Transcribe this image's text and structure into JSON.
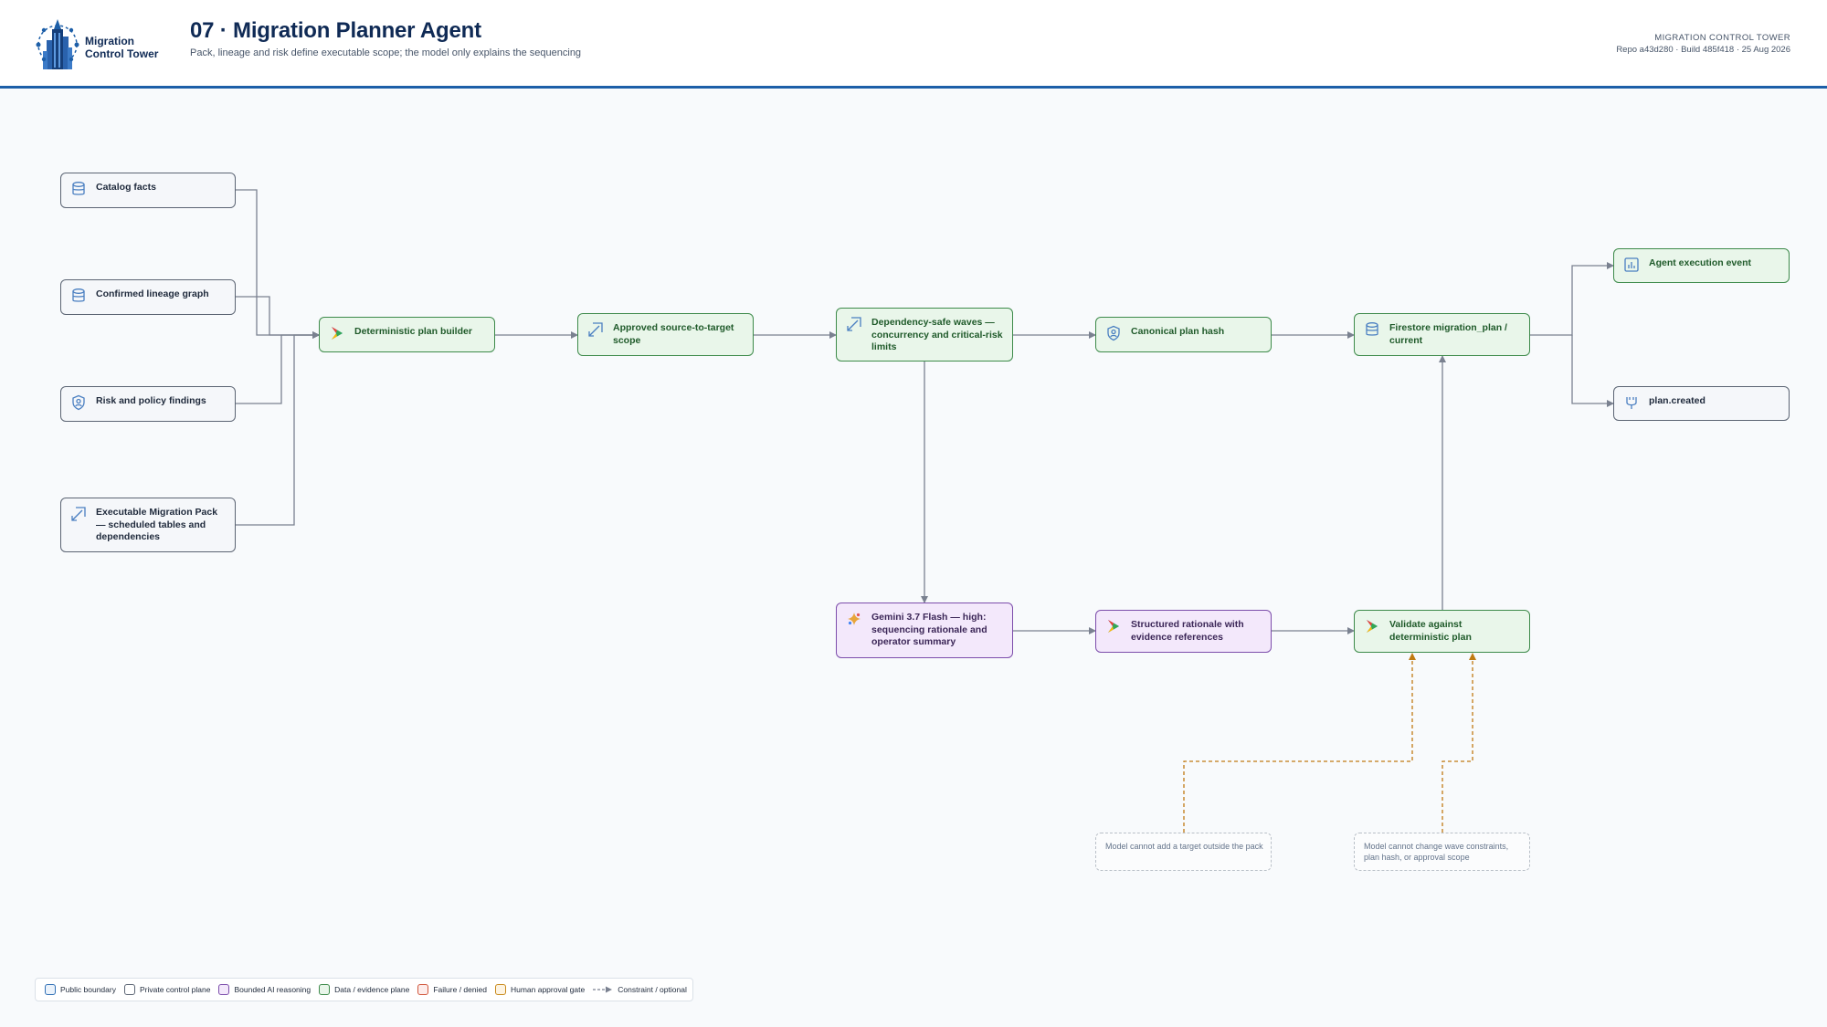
{
  "header": {
    "logo_line1": "Migration",
    "logo_line2": "Control Tower",
    "title": "07 · Migration Planner Agent",
    "subtitle": "Pack, lineage and risk define executable scope; the model only explains the sequencing",
    "meta_kicker": "MIGRATION CONTROL TOWER",
    "meta_build": "Repo a43d280 · Build 485f418 · 25 Aug 2026"
  },
  "nodes": {
    "catalog_facts": {
      "label": "Catalog facts",
      "icon": "database-icon",
      "kind": "private"
    },
    "lineage_graph": {
      "label": "Confirmed lineage graph",
      "icon": "database-icon",
      "kind": "private"
    },
    "risk_findings": {
      "label": "Risk and policy findings",
      "icon": "shield-person-icon",
      "kind": "private"
    },
    "migration_pack": {
      "label": "Executable Migration Pack — scheduled tables and dependencies",
      "icon": "scope-arrow-icon",
      "kind": "private"
    },
    "plan_builder": {
      "label": "Deterministic plan builder",
      "icon": "cloud-run-icon",
      "kind": "data"
    },
    "approved_scope": {
      "label": "Approved source-to-target scope",
      "icon": "scope-arrow-icon",
      "kind": "data"
    },
    "waves": {
      "label": "Dependency-safe waves — concurrency and critical-risk limits",
      "icon": "scope-arrow-icon",
      "kind": "data"
    },
    "plan_hash": {
      "label": "Canonical plan hash",
      "icon": "shield-person-icon",
      "kind": "data"
    },
    "firestore": {
      "label": "Firestore migration_plan / current",
      "icon": "database-icon",
      "kind": "data"
    },
    "agent_event": {
      "label": "Agent execution event",
      "icon": "chart-icon",
      "kind": "data"
    },
    "plan_created": {
      "label": "plan.created",
      "icon": "pubsub-icon",
      "kind": "private"
    },
    "gemini": {
      "label": "Gemini 3.7 Flash — high: sequencing rationale and operator summary",
      "icon": "gemini-icon",
      "kind": "ai"
    },
    "rationale": {
      "label": "Structured rationale with evidence references",
      "icon": "cloud-run-icon",
      "kind": "ai"
    },
    "validate": {
      "label": "Validate against deterministic plan",
      "icon": "cloud-run-icon",
      "kind": "data"
    },
    "note_target": {
      "label": "Model cannot add a target outside the pack",
      "kind": "note"
    },
    "note_wave": {
      "label": "Model cannot change wave constraints, plan hash, or approval scope",
      "kind": "note"
    }
  },
  "legend": [
    {
      "label": "Public boundary",
      "color": "#2f6fb5",
      "fill": "#eaf2fb"
    },
    {
      "label": "Private control plane",
      "color": "#5b6473",
      "fill": "#ffffff"
    },
    {
      "label": "Bounded AI reasoning",
      "color": "#7c4dab",
      "fill": "#f3e8fb"
    },
    {
      "label": "Data / evidence plane",
      "color": "#3d8a4a",
      "fill": "#e9f6ea"
    },
    {
      "label": "Failure / denied",
      "color": "#d0563b",
      "fill": "#fdecea"
    },
    {
      "label": "Human approval gate",
      "color": "#c98a1b",
      "fill": "#fdf3e1"
    },
    {
      "label": "Constraint / optional",
      "color": "#7a8190",
      "fill": "none"
    }
  ],
  "colors": {
    "edge": "#7a8190",
    "constraint": "#c07a12",
    "accent": "#1d5fa8"
  }
}
